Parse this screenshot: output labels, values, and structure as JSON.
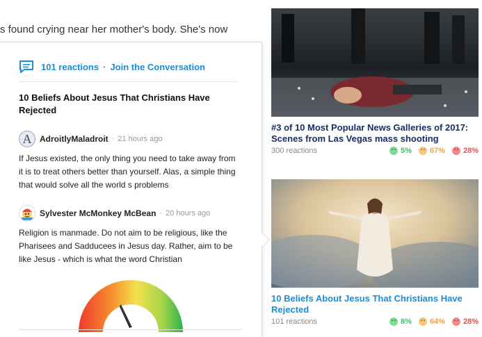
{
  "article": {
    "snippet": "s found crying near her mother's body. She's now"
  },
  "conversation": {
    "header_count": "101 reactions",
    "separator": "·",
    "header_link": "Join the Conversation",
    "title": "10 Beliefs About Jesus That Christians Have Rejected",
    "comments": [
      {
        "avatar_letter": "A",
        "author": "AdroitlyMaladroit",
        "dot": "·",
        "time": "21 hours ago",
        "body": "If Jesus existed, the only thing you need to take away from it is to treat others better than yourself. Alas, a simple thing that would solve all the world s problems"
      },
      {
        "author": "Sylvester McMonkey McBean",
        "dot": "·",
        "time": "20 hours ago",
        "body": "Religion is manmade. Do not aim to be religious, like the Pharisees and Sadducees in Jesus day. Rather, aim to be like Jesus - which is what the word Christian"
      }
    ]
  },
  "cards": [
    {
      "title": "#3 of 10 Most Popular News Galleries of 2017: Scenes from Las Vegas mass shooting",
      "title_color": "#1c2b63",
      "reactions": "300 reactions",
      "happy": "5%",
      "meh": "67%",
      "sad": "28%"
    },
    {
      "title": "10 Beliefs About Jesus That Christians Have Rejected",
      "title_color": "#1a8cd8",
      "reactions": "101 reactions",
      "happy": "8%",
      "meh": "64%",
      "sad": "28%"
    }
  ],
  "colors": {
    "accent": "#1a8cd8",
    "happy": "#3ac26a",
    "meh": "#f3a23b",
    "sad": "#ef4c4c"
  },
  "icons": [
    "chat-bubble-icon",
    "happy-face-icon",
    "meh-face-icon",
    "sad-face-icon",
    "gauge-icon"
  ]
}
